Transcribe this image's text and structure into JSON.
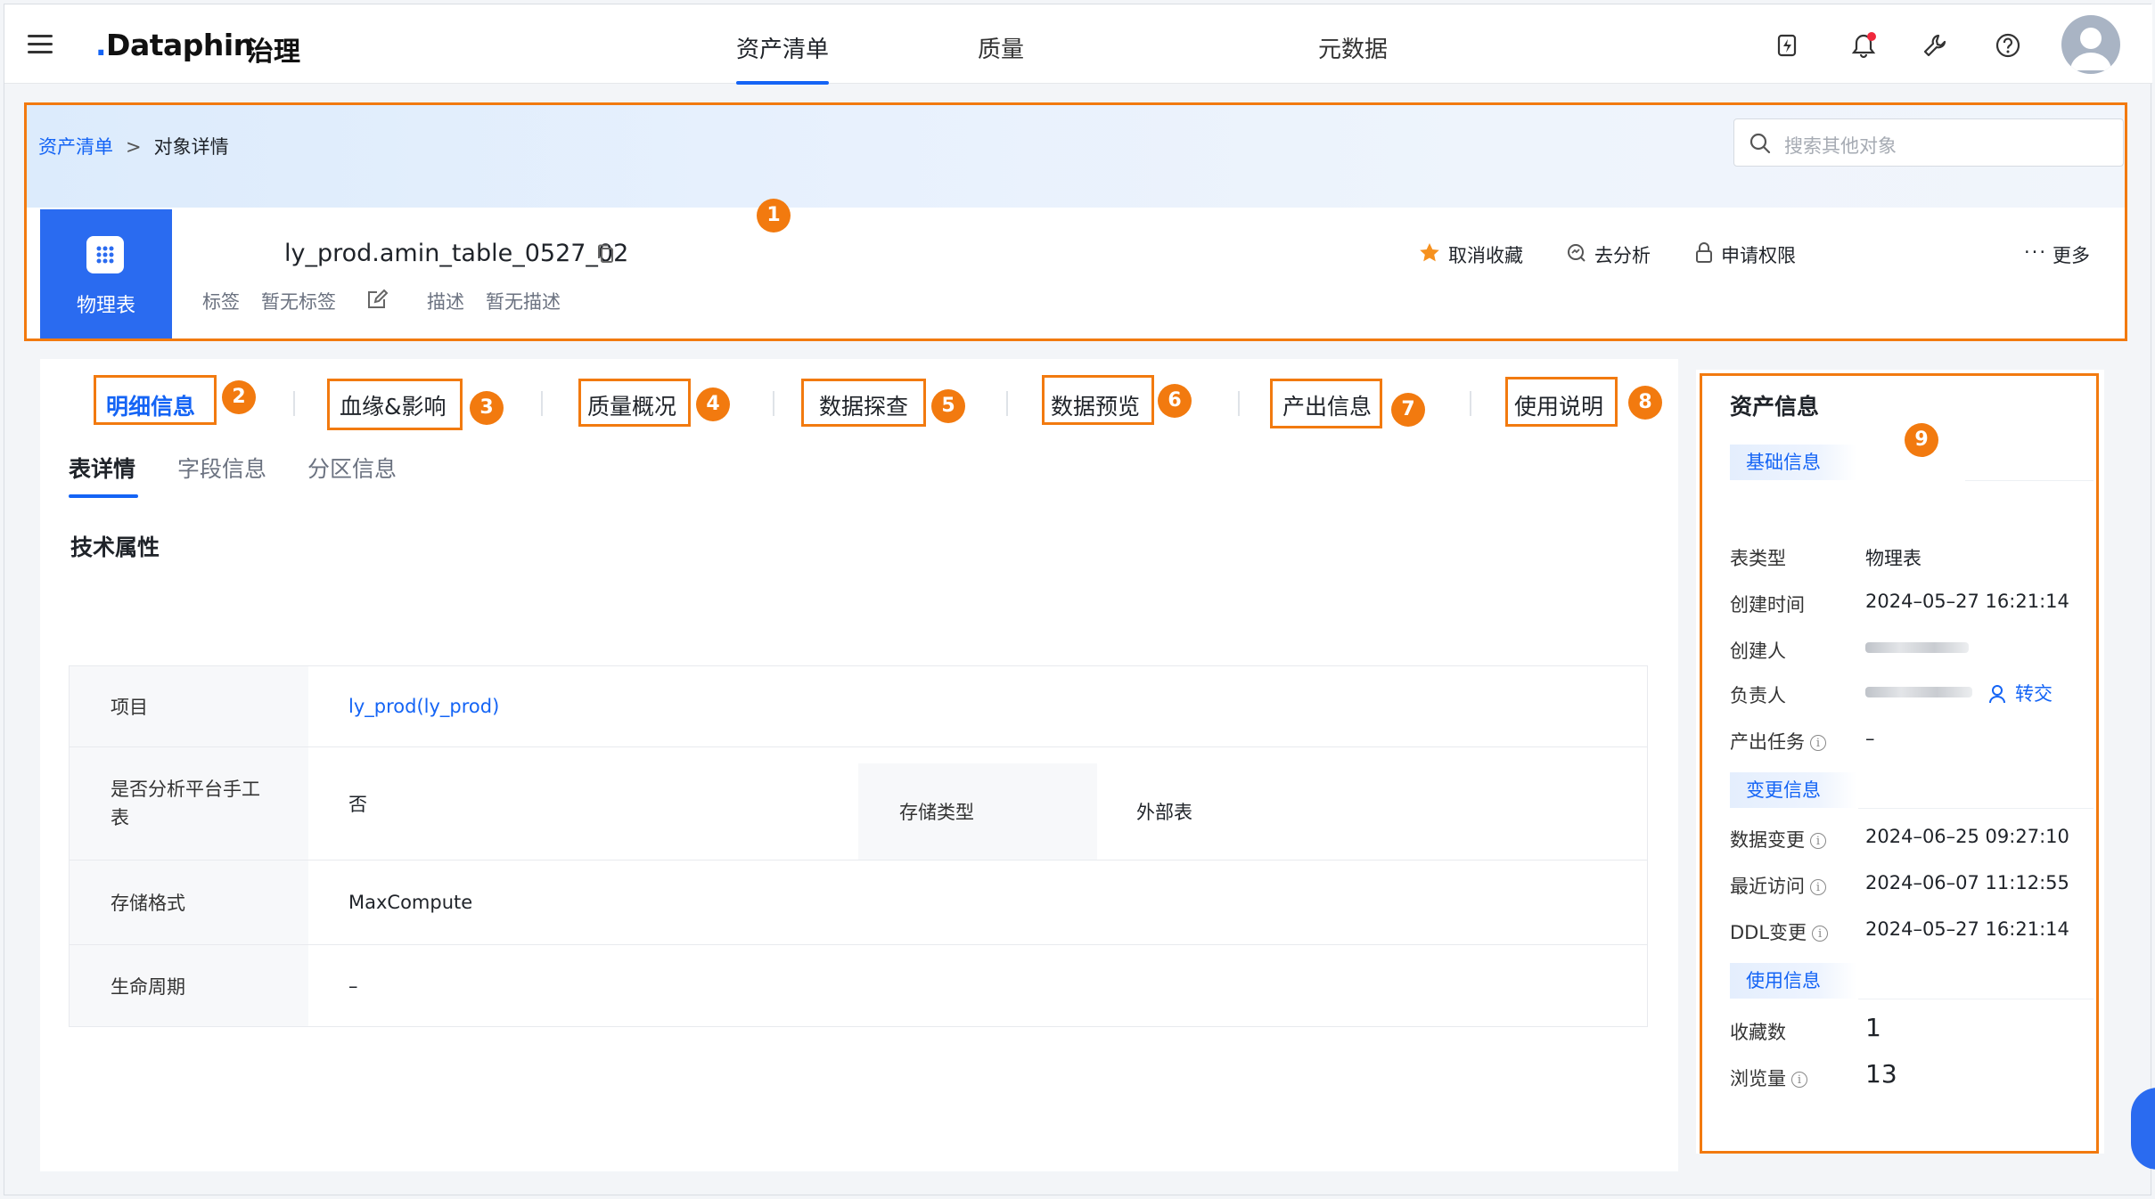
{
  "app": {
    "logo": "Dataphin",
    "module": "治理"
  },
  "nav": {
    "tabs": [
      "资产清单",
      "质量",
      "元数据"
    ],
    "active_index": 0
  },
  "breadcrumb": {
    "parent": "资产清单",
    "separator": ">",
    "current": "对象详情"
  },
  "search": {
    "placeholder": "搜索其他对象"
  },
  "object": {
    "type_label": "物理表",
    "name": "ly_prod.amin_table_0527_02",
    "tag_label": "标签",
    "tag_value": "暂无标签",
    "desc_label": "描述",
    "desc_value": "暂无描述"
  },
  "actions": {
    "unfavorite": "取消收藏",
    "analyze": "去分析",
    "request": "申请权限",
    "more": "更多"
  },
  "detail_tabs": [
    "明细信息",
    "血缘&影响",
    "质量概况",
    "数据探查",
    "数据预览",
    "产出信息",
    "使用说明"
  ],
  "sub_tabs": [
    "表详情",
    "字段信息",
    "分区信息"
  ],
  "section_title": "技术属性",
  "props": {
    "project_key": "项目",
    "project_val": "ly_prod(ly_prod)",
    "manual_key": "是否分析平台手工表",
    "manual_val": "否",
    "storage_type_key": "存储类型",
    "storage_type_val": "外部表",
    "format_key": "存储格式",
    "format_val": "MaxCompute",
    "lifecycle_key": "生命周期",
    "lifecycle_val": "–"
  },
  "side": {
    "title": "资产信息",
    "basic": {
      "label": "基础信息",
      "table_type_key": "表类型",
      "table_type_val": "物理表",
      "created_key": "创建时间",
      "created_val": "2024–05–27 16:21:14",
      "creator_key": "创建人",
      "owner_key": "负责人",
      "transfer": "转交",
      "task_key": "产出任务",
      "task_val": "–"
    },
    "change": {
      "label": "变更信息",
      "data_change_key": "数据变更",
      "data_change_val": "2024–06–25 09:27:10",
      "visit_key": "最近访问",
      "visit_val": "2024–06–07 11:12:55",
      "ddl_key": "DDL变更",
      "ddl_val": "2024–05–27 16:21:14"
    },
    "usage": {
      "label": "使用信息",
      "fav_key": "收藏数",
      "fav_val": "1",
      "view_key": "浏览量",
      "view_val": "13"
    }
  },
  "annotations": [
    "1",
    "2",
    "3",
    "4",
    "5",
    "6",
    "7",
    "8",
    "9"
  ],
  "colors": {
    "accent": "#1464f5",
    "annotation": "#f27a0f",
    "badge": "#2a6bf0"
  }
}
